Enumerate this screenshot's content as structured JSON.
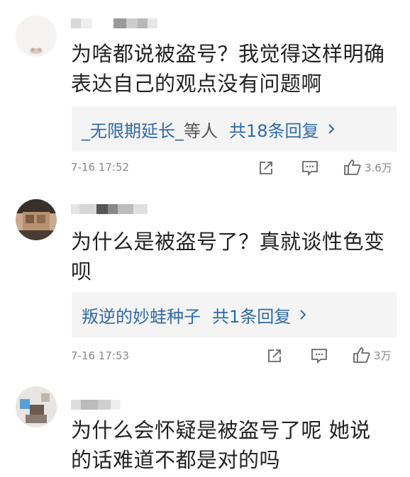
{
  "comments": [
    {
      "text": "为啥都说被盗号？我觉得这样明确表达自己的观点没有问题啊",
      "reply": {
        "users": "_无限期延长_",
        "suffix": "等人",
        "count": "共18条回复"
      },
      "time": "7-16 17:52",
      "likes": "3.6万"
    },
    {
      "text": "为什么是被盗号了？真就谈性色变呗",
      "reply": {
        "users": "叛逆的妙蛙种子",
        "suffix": "",
        "count": "共1条回复"
      },
      "time": "7-16 17:53",
      "likes": "3万"
    },
    {
      "text": "为什么会怀疑是被盗号了呢 她说的话难道不都是对的吗"
    }
  ],
  "icons": {
    "share": "share-icon",
    "comment": "comment-icon",
    "like": "thumbs-up-icon",
    "chevron": "chevron-right-icon"
  },
  "colors": {
    "link": "#2f6aa8",
    "text": "#222222",
    "meta": "#888888",
    "reply_bg": "#f4f4f4"
  }
}
